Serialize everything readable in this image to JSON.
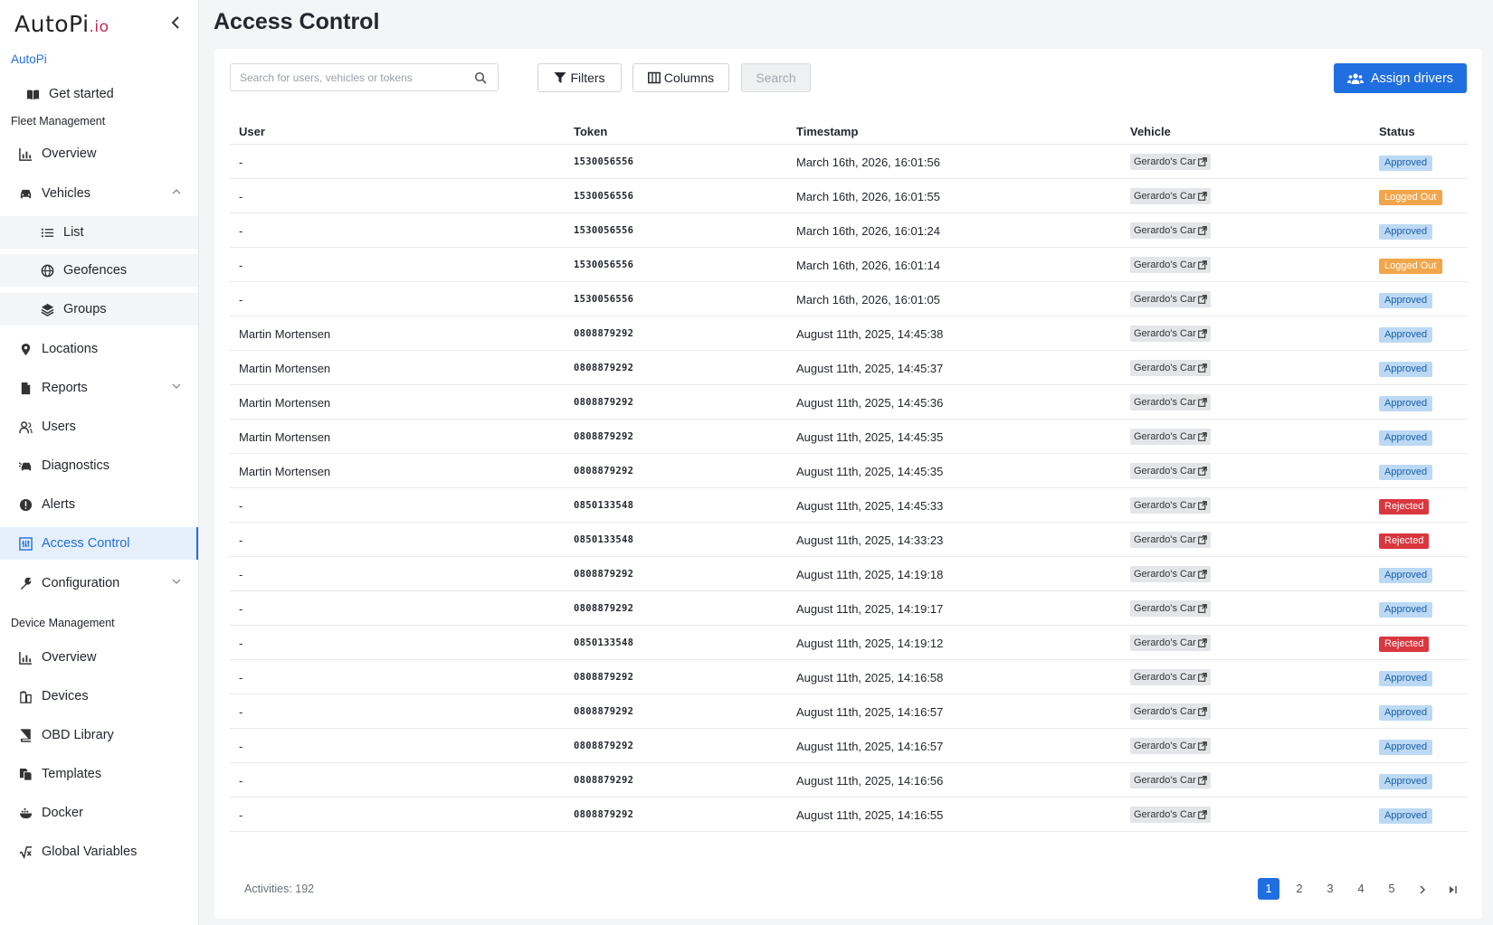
{
  "sidebar": {
    "logo_main": "AutoPi",
    "logo_suffix": ".io",
    "collapse_icon": "chevron-left-icon",
    "org_name": "AutoPi",
    "get_started": "Get started",
    "fleet_section": "Fleet Management",
    "fleet_overview": "Overview",
    "vehicles": "Vehicles",
    "vehicles_list": "List",
    "vehicles_geofences": "Geofences",
    "vehicles_groups": "Groups",
    "locations": "Locations",
    "reports": "Reports",
    "users": "Users",
    "diagnostics": "Diagnostics",
    "alerts": "Alerts",
    "access_control": "Access Control",
    "configuration": "Configuration",
    "device_section": "Device Management",
    "device_overview": "Overview",
    "devices": "Devices",
    "obd_library": "OBD Library",
    "templates": "Templates",
    "docker": "Docker",
    "global_variables": "Global Variables"
  },
  "page": {
    "title": "Access Control"
  },
  "toolbar": {
    "search_placeholder": "Search for users, vehicles or tokens",
    "filters": "Filters",
    "columns": "Columns",
    "search": "Search",
    "assign_drivers": "Assign drivers"
  },
  "table": {
    "headers": {
      "user": "User",
      "token": "Token",
      "timestamp": "Timestamp",
      "vehicle": "Vehicle",
      "status": "Status"
    },
    "rows": [
      {
        "user": "-",
        "token": "1530056556",
        "timestamp": "March 16th, 2026, 16:01:56",
        "vehicle": "Gerardo's Car",
        "status": "Approved",
        "status_type": "approved"
      },
      {
        "user": "-",
        "token": "1530056556",
        "timestamp": "March 16th, 2026, 16:01:55",
        "vehicle": "Gerardo's Car",
        "status": "Logged Out",
        "status_type": "logged"
      },
      {
        "user": "-",
        "token": "1530056556",
        "timestamp": "March 16th, 2026, 16:01:24",
        "vehicle": "Gerardo's Car",
        "status": "Approved",
        "status_type": "approved"
      },
      {
        "user": "-",
        "token": "1530056556",
        "timestamp": "March 16th, 2026, 16:01:14",
        "vehicle": "Gerardo's Car",
        "status": "Logged Out",
        "status_type": "logged"
      },
      {
        "user": "-",
        "token": "1530056556",
        "timestamp": "March 16th, 2026, 16:01:05",
        "vehicle": "Gerardo's Car",
        "status": "Approved",
        "status_type": "approved"
      },
      {
        "user": "Martin Mortensen",
        "token": "0808879292",
        "timestamp": "August 11th, 2025, 14:45:38",
        "vehicle": "Gerardo's Car",
        "status": "Approved",
        "status_type": "approved"
      },
      {
        "user": "Martin Mortensen",
        "token": "0808879292",
        "timestamp": "August 11th, 2025, 14:45:37",
        "vehicle": "Gerardo's Car",
        "status": "Approved",
        "status_type": "approved"
      },
      {
        "user": "Martin Mortensen",
        "token": "0808879292",
        "timestamp": "August 11th, 2025, 14:45:36",
        "vehicle": "Gerardo's Car",
        "status": "Approved",
        "status_type": "approved"
      },
      {
        "user": "Martin Mortensen",
        "token": "0808879292",
        "timestamp": "August 11th, 2025, 14:45:35",
        "vehicle": "Gerardo's Car",
        "status": "Approved",
        "status_type": "approved"
      },
      {
        "user": "Martin Mortensen",
        "token": "0808879292",
        "timestamp": "August 11th, 2025, 14:45:35",
        "vehicle": "Gerardo's Car",
        "status": "Approved",
        "status_type": "approved"
      },
      {
        "user": "-",
        "token": "0850133548",
        "timestamp": "August 11th, 2025, 14:45:33",
        "vehicle": "Gerardo's Car",
        "status": "Rejected",
        "status_type": "rejected"
      },
      {
        "user": "-",
        "token": "0850133548",
        "timestamp": "August 11th, 2025, 14:33:23",
        "vehicle": "Gerardo's Car",
        "status": "Rejected",
        "status_type": "rejected"
      },
      {
        "user": "-",
        "token": "0808879292",
        "timestamp": "August 11th, 2025, 14:19:18",
        "vehicle": "Gerardo's Car",
        "status": "Approved",
        "status_type": "approved"
      },
      {
        "user": "-",
        "token": "0808879292",
        "timestamp": "August 11th, 2025, 14:19:17",
        "vehicle": "Gerardo's Car",
        "status": "Approved",
        "status_type": "approved"
      },
      {
        "user": "-",
        "token": "0850133548",
        "timestamp": "August 11th, 2025, 14:19:12",
        "vehicle": "Gerardo's Car",
        "status": "Rejected",
        "status_type": "rejected"
      },
      {
        "user": "-",
        "token": "0808879292",
        "timestamp": "August 11th, 2025, 14:16:58",
        "vehicle": "Gerardo's Car",
        "status": "Approved",
        "status_type": "approved"
      },
      {
        "user": "-",
        "token": "0808879292",
        "timestamp": "August 11th, 2025, 14:16:57",
        "vehicle": "Gerardo's Car",
        "status": "Approved",
        "status_type": "approved"
      },
      {
        "user": "-",
        "token": "0808879292",
        "timestamp": "August 11th, 2025, 14:16:57",
        "vehicle": "Gerardo's Car",
        "status": "Approved",
        "status_type": "approved"
      },
      {
        "user": "-",
        "token": "0808879292",
        "timestamp": "August 11th, 2025, 14:16:56",
        "vehicle": "Gerardo's Car",
        "status": "Approved",
        "status_type": "approved"
      },
      {
        "user": "-",
        "token": "0808879292",
        "timestamp": "August 11th, 2025, 14:16:55",
        "vehicle": "Gerardo's Car",
        "status": "Approved",
        "status_type": "approved"
      }
    ]
  },
  "footer": {
    "activities": "Activities: 192",
    "pages": [
      "1",
      "2",
      "3",
      "4",
      "5"
    ],
    "current_page": "1",
    "next_icon": "chevron-right-icon",
    "last_icon": "last-page-icon"
  },
  "colors": {
    "accent": "#1f6fe0",
    "approved_bg": "#bcd9f4",
    "logged_out_bg": "#f2a64b",
    "rejected_bg": "#d9363e"
  }
}
